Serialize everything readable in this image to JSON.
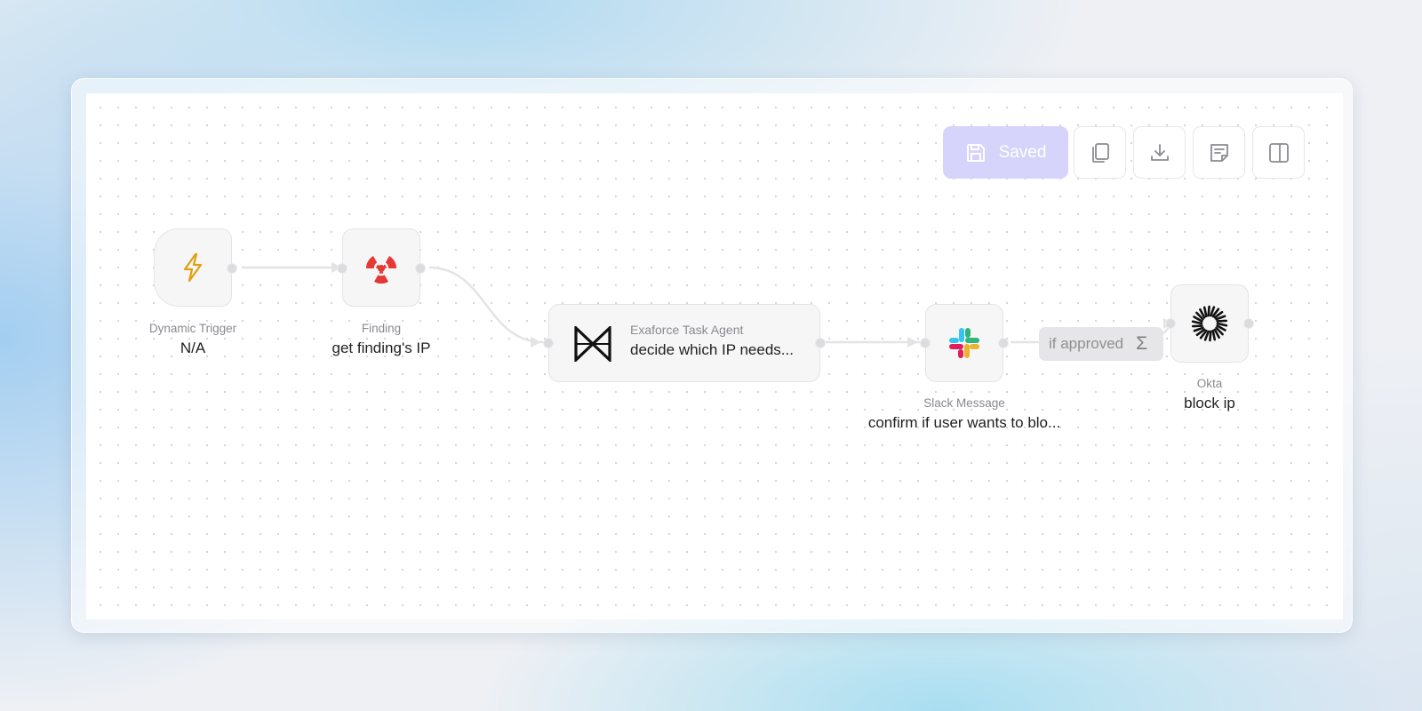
{
  "toolbar": {
    "saved_label": "Saved",
    "buttons": [
      {
        "name": "copy-button",
        "icon": "copy-icon"
      },
      {
        "name": "download-button",
        "icon": "download-icon"
      },
      {
        "name": "notes-button",
        "icon": "note-icon"
      },
      {
        "name": "panel-toggle-button",
        "icon": "sidebar-panel-icon"
      }
    ],
    "saved_color": "#d6d4fb"
  },
  "workflow": {
    "nodes": [
      {
        "id": "trigger",
        "type_label": "Dynamic Trigger",
        "title": "N/A",
        "icon": "lightning-icon",
        "icon_color": "#e0a010"
      },
      {
        "id": "finding",
        "type_label": "Finding",
        "title": "get finding's IP",
        "icon": "radiation-icon",
        "icon_color": "#e53935"
      },
      {
        "id": "agent",
        "type_label": "Exaforce Task Agent",
        "title": "decide which IP needs...",
        "icon": "exaforce-logo-icon"
      },
      {
        "id": "slack",
        "type_label": "Slack Message",
        "title": "confirm if user wants to blo...",
        "icon": "slack-logo-icon"
      },
      {
        "id": "okta",
        "type_label": "Okta",
        "title": "block ip",
        "icon": "okta-logo-icon"
      }
    ],
    "edge_label": {
      "text": "if approved",
      "icon": "sigma-icon",
      "symbol": "Σ"
    }
  }
}
